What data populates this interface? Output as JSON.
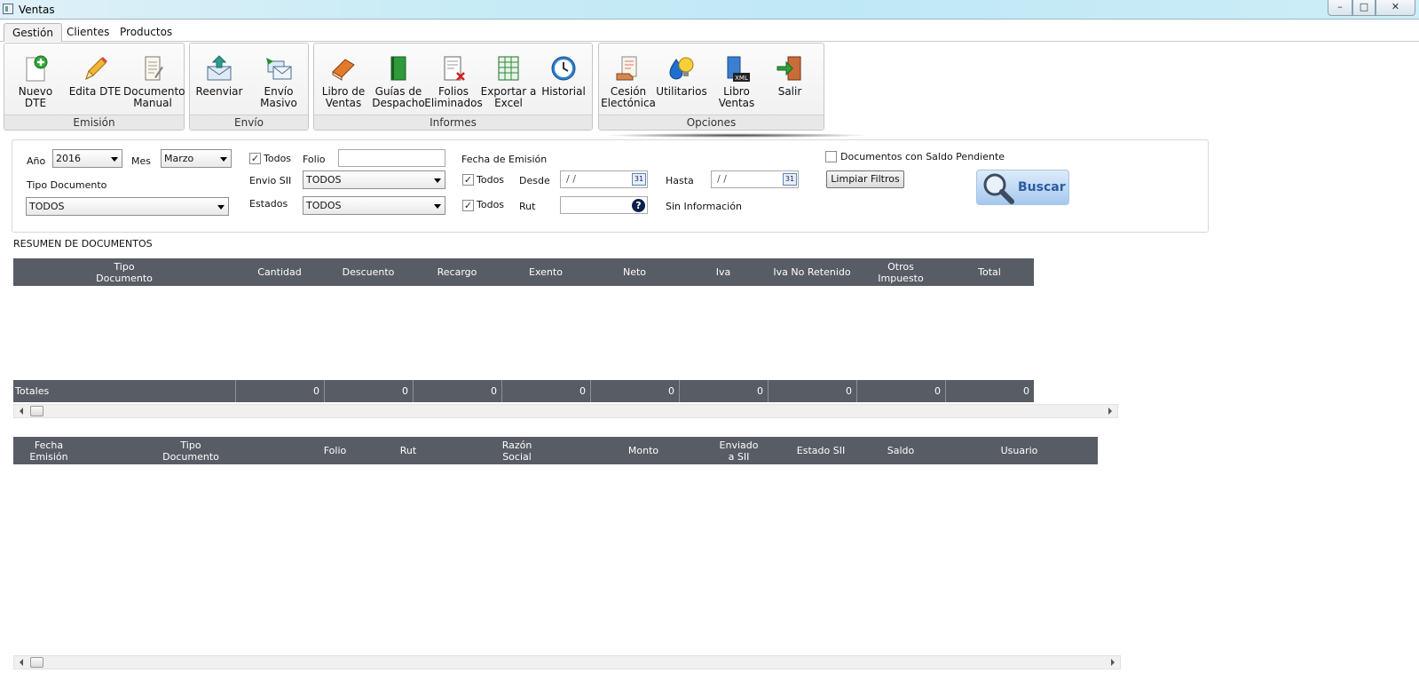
{
  "window": {
    "title": "Ventas",
    "min": "–",
    "max": "□",
    "close": "✕"
  },
  "tabs": [
    "Gestión",
    "Clientes",
    "Productos"
  ],
  "ribbon": {
    "groups": [
      {
        "caption": "Emisión",
        "buttons": [
          {
            "label": "Nuevo DTE",
            "icon": "new-document-icon"
          },
          {
            "label": "Edita DTE",
            "icon": "pencil-icon"
          },
          {
            "label": "Documento Manual",
            "icon": "manual-document-icon"
          }
        ]
      },
      {
        "caption": "Envío",
        "buttons": [
          {
            "label": "Reenviar",
            "icon": "resend-mail-icon"
          },
          {
            "label": "Envío Masivo",
            "icon": "mass-mail-icon"
          }
        ]
      },
      {
        "caption": "Informes",
        "buttons": [
          {
            "label": "Libro de Ventas",
            "icon": "sales-book-icon"
          },
          {
            "label": "Guías de Despacho",
            "icon": "dispatch-guide-icon"
          },
          {
            "label": "Folios Eliminados",
            "icon": "deleted-folios-icon"
          },
          {
            "label": "Exportar a Excel",
            "icon": "excel-icon"
          },
          {
            "label": "Historial",
            "icon": "history-clock-icon"
          }
        ]
      },
      {
        "caption": "Opciones",
        "buttons": [
          {
            "label": "Cesión Electónica",
            "icon": "assignment-icon"
          },
          {
            "label": "Utilitarios",
            "icon": "utilities-icon"
          },
          {
            "label": "Libro Ventas",
            "icon": "xml-book-icon",
            "badge": "XML"
          },
          {
            "label": "Salir",
            "icon": "exit-door-icon"
          }
        ]
      }
    ]
  },
  "filters": {
    "anio_label": "Año",
    "anio_value": "2016",
    "mes_label": "Mes",
    "mes_value": "Marzo",
    "tipo_doc_label": "Tipo Documento",
    "tipo_doc_value": "TODOS",
    "todos_folio_label": "Todos",
    "todos_folio_checked": true,
    "folio_label": "Folio",
    "folio_value": "",
    "envio_sii_label": "Envio SII",
    "envio_sii_value": "TODOS",
    "estados_label": "Estados",
    "estados_value": "TODOS",
    "fecha_emision_label": "Fecha de Emisión",
    "todos_fecha_label": "Todos",
    "todos_fecha_checked": true,
    "desde_label": "Desde",
    "desde_value": " / /",
    "hasta_label": "Hasta",
    "hasta_value": " / /",
    "todos_rut_label": "Todos",
    "todos_rut_checked": true,
    "rut_label": "Rut",
    "rut_value": "",
    "sin_info": "Sin Información",
    "saldo_pendiente_label": "Documentos con Saldo Pendiente",
    "saldo_pendiente_checked": false,
    "limpiar_label": "Limpiar Filtros",
    "buscar_label": "Buscar",
    "calendar_glyph": "31",
    "help_glyph": "?"
  },
  "resumen": {
    "title": "RESUMEN DE DOCUMENTOS",
    "columns": [
      "Tipo\nDocumento",
      "Cantidad",
      "Descuento",
      "Recargo",
      "Exento",
      "Neto",
      "Iva",
      "Iva No Retenido",
      "Otros\nImpuesto",
      "Total"
    ],
    "totals_label": "Totales",
    "totals": [
      "0",
      "0",
      "0",
      "0",
      "0",
      "0",
      "0",
      "0",
      "0"
    ]
  },
  "detalle": {
    "columns": [
      "Fecha\nEmisión",
      "Tipo\nDocumento",
      "Folio",
      "Rut",
      "Razón\nSocial",
      "Monto",
      "Enviado\na SII",
      "Estado SII",
      "Saldo",
      "Usuario"
    ]
  },
  "colors": {
    "grid_header": "#585c64",
    "accent": "#2d5aa4"
  }
}
